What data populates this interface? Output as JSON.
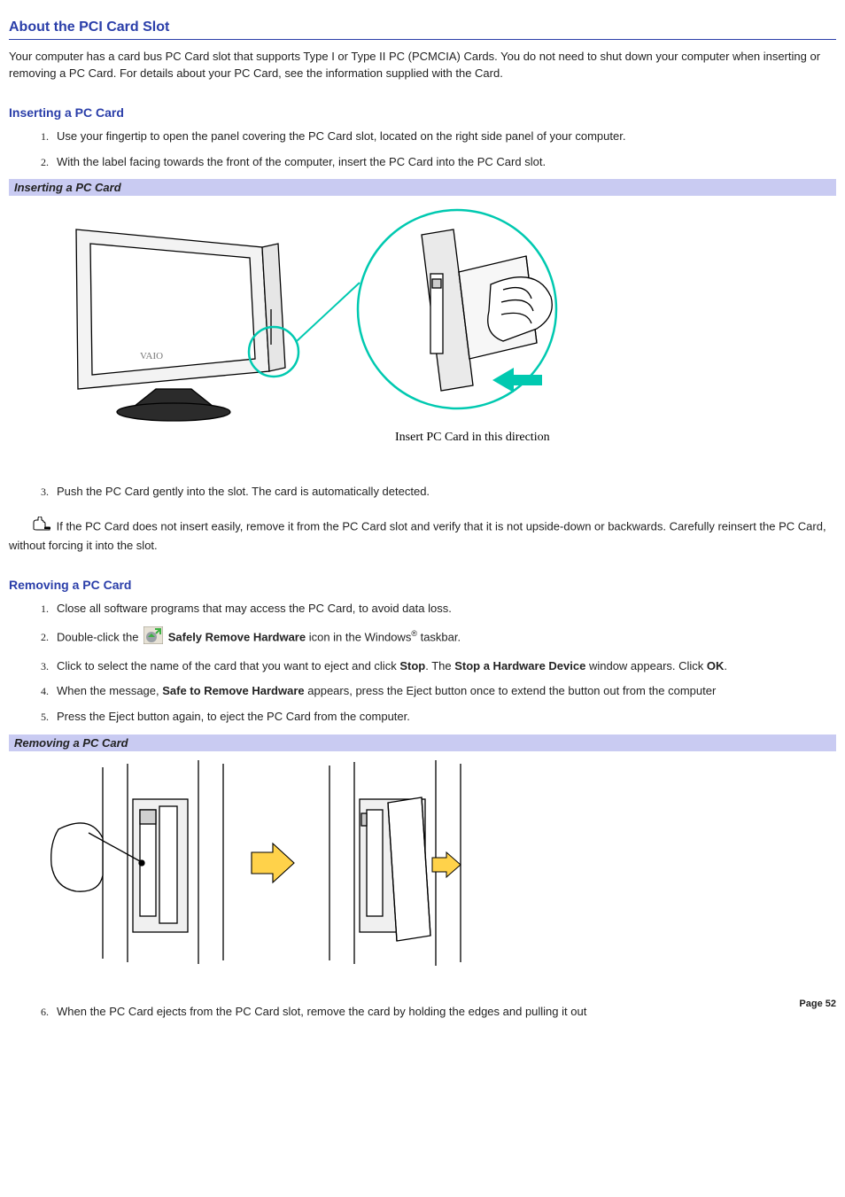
{
  "title": "About the PCI Card Slot",
  "intro": "Your computer has a card bus PC Card slot that supports Type I or Type II PC (PCMCIA) Cards. You do not need to shut down your computer when inserting or removing a PC Card. For details about your PC Card, see the information supplied with the Card.",
  "section_insert": "Inserting a PC Card",
  "insert_steps": [
    "Use your fingertip to open the panel covering the PC Card slot, located on the right side panel of your computer.",
    "With the label facing towards the front of the computer, insert the PC Card into the PC Card slot."
  ],
  "fig1_label": "Inserting a PC Card",
  "fig1_caption": "Insert PC Card in this direction",
  "insert_step3": "Push the PC Card gently into the slot. The card is automatically detected.",
  "note_text": " If the PC Card does not insert easily, remove it from the PC Card slot and verify that it is not upside-down or backwards. Carefully reinsert the PC Card, without forcing it into the slot.",
  "section_remove": "Removing a PC Card",
  "remove_steps": {
    "s1": "Close all software programs that may access the PC Card, to avoid data loss.",
    "s2_a": "Double-click the ",
    "s2_b_bold": "Safely Remove Hardware",
    "s2_c": " icon in the Windows",
    "s2_reg": "®",
    "s2_d": " taskbar.",
    "s3_a": "Click to select the name of the card that you want to eject and click ",
    "s3_b_bold": "Stop",
    "s3_c": ". The ",
    "s3_d_bold": "Stop a Hardware Device",
    "s3_e": " window appears. Click ",
    "s3_f_bold": "OK",
    "s3_g": ".",
    "s4_a": "When the message, ",
    "s4_b_bold": "Safe to Remove Hardware",
    "s4_c": " appears, press the Eject button once to extend the button out from the computer",
    "s5": "Press the Eject button again, to eject the PC Card from the computer."
  },
  "fig2_label": "Removing a PC Card",
  "remove_step6": "When the PC Card ejects from the PC Card slot, remove the card by holding the edges and pulling it out",
  "page_number": "Page 52"
}
